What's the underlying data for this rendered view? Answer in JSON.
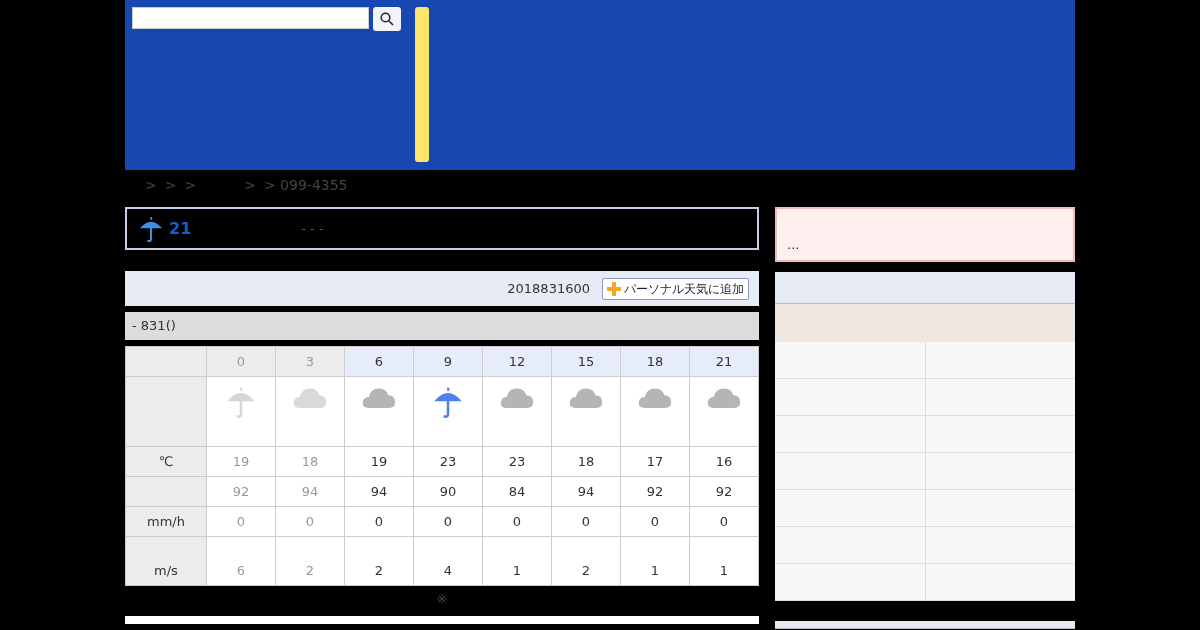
{
  "breadcrumb": [
    ">",
    ">",
    ">",
    ">",
    "> 099-4355"
  ],
  "current": {
    "kind": "rain",
    "temp": "21",
    "detail": "- - -"
  },
  "forecast_header": {
    "issued": "2018831600",
    "add_button": "パーソナル天気に追加"
  },
  "day_title": "- 831()",
  "table": {
    "row_labels": {
      "temp": "℃",
      "precip": "mm/h",
      "wind": "m/s"
    },
    "columns": [
      {
        "hour": "0",
        "past": true,
        "kind": "rain",
        "temp": "19",
        "humidity": "92",
        "precip": "0",
        "wind": "6"
      },
      {
        "hour": "3",
        "past": true,
        "kind": "cloudy",
        "temp": "18",
        "humidity": "94",
        "precip": "0",
        "wind": "2"
      },
      {
        "hour": "6",
        "past": false,
        "kind": "cloudy",
        "temp": "19",
        "humidity": "94",
        "precip": "0",
        "wind": "2"
      },
      {
        "hour": "9",
        "past": false,
        "kind": "rain",
        "temp": "23",
        "humidity": "90",
        "precip": "0",
        "wind": "4"
      },
      {
        "hour": "12",
        "past": false,
        "kind": "cloudy",
        "temp": "23",
        "humidity": "84",
        "precip": "0",
        "wind": "1"
      },
      {
        "hour": "15",
        "past": false,
        "kind": "cloudy",
        "temp": "18",
        "humidity": "94",
        "precip": "0",
        "wind": "2"
      },
      {
        "hour": "18",
        "past": false,
        "kind": "cloudy",
        "temp": "17",
        "humidity": "92",
        "precip": "0",
        "wind": "1"
      },
      {
        "hour": "21",
        "past": false,
        "kind": "cloudy",
        "temp": "16",
        "humidity": "92",
        "precip": "0",
        "wind": "1"
      }
    ]
  },
  "note": "※",
  "sidebar": {
    "alert_link": "..."
  }
}
